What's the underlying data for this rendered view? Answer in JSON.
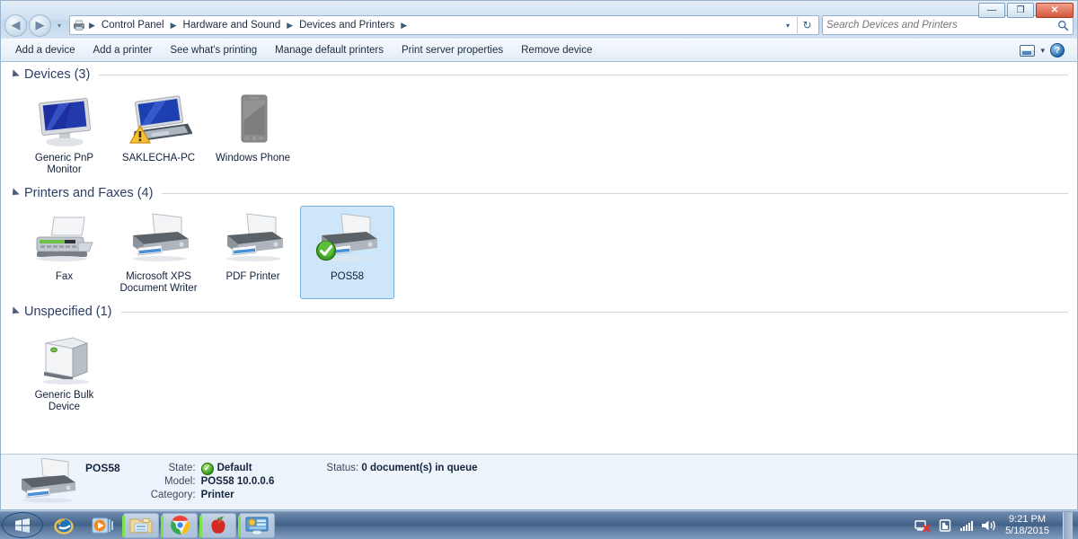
{
  "window": {
    "caption_buttons": [
      {
        "name": "minimize",
        "glyph": "—"
      },
      {
        "name": "maximize",
        "glyph": "❐"
      },
      {
        "name": "close",
        "glyph": "✕"
      }
    ],
    "address": {
      "icon": "devices-printers-icon",
      "breadcrumbs": [
        "Control Panel",
        "Hardware and Sound",
        "Devices and Printers"
      ],
      "separator": "▶",
      "dropdown_glyph": "▾",
      "refresh_glyph": "↻"
    },
    "search": {
      "placeholder": "Search Devices and Printers",
      "value": "",
      "icon": "search-icon"
    },
    "nav": {
      "back_glyph": "◀",
      "forward_glyph": "▶",
      "recent_glyph": "▾"
    }
  },
  "toolbar": {
    "items": [
      "Add a device",
      "Add a printer",
      "See what's printing",
      "Manage default printers",
      "Print server properties",
      "Remove device"
    ],
    "view_chevron": "▾",
    "help_glyph": "?"
  },
  "groups": [
    {
      "title": "Devices (3)",
      "items": [
        {
          "label": "Generic PnP Monitor",
          "icon": "monitor-icon",
          "selected": false,
          "badge": ""
        },
        {
          "label": "SAKLECHA-PC",
          "icon": "laptop-icon",
          "selected": false,
          "badge": "warning-badge"
        },
        {
          "label": "Windows Phone",
          "icon": "phone-icon",
          "selected": false,
          "badge": ""
        }
      ]
    },
    {
      "title": "Printers and Faxes (4)",
      "items": [
        {
          "label": "Fax",
          "icon": "fax-icon",
          "selected": false,
          "badge": ""
        },
        {
          "label": "Microsoft XPS Document Writer",
          "icon": "printer-icon",
          "selected": false,
          "badge": ""
        },
        {
          "label": "PDF Printer",
          "icon": "printer-icon",
          "selected": false,
          "badge": ""
        },
        {
          "label": "POS58",
          "icon": "printer-icon",
          "selected": true,
          "badge": "default-check-badge"
        }
      ]
    },
    {
      "title": "Unspecified (1)",
      "items": [
        {
          "label": "Generic Bulk Device",
          "icon": "bulk-device-icon",
          "selected": false,
          "badge": ""
        }
      ]
    }
  ],
  "details": {
    "icon": "printer-icon",
    "name": "POS58",
    "labels": [
      "State:",
      "Model:",
      "Category:"
    ],
    "state_value": "Default",
    "model_value": "POS58 10.0.0.6",
    "category_value": "Printer",
    "status_label": "Status:",
    "status_value": "0 document(s) in queue"
  },
  "taskbar": {
    "start": "start-orb",
    "buttons": [
      {
        "name": "internet-explorer",
        "active": false,
        "pinned": false
      },
      {
        "name": "windows-media-player",
        "active": false,
        "pinned": false
      },
      {
        "name": "windows-explorer",
        "active": true,
        "pinned": true
      },
      {
        "name": "google-chrome",
        "active": true,
        "pinned": true
      },
      {
        "name": "apple-app",
        "active": true,
        "pinned": true
      },
      {
        "name": "control-panel",
        "active": true,
        "pinned": true
      }
    ],
    "tray": {
      "network_icon": "network-error-icon",
      "action_center_icon": "action-center-flag-icon",
      "signal_icon": "signal-bars-icon",
      "volume_icon": "volume-icon"
    },
    "clock": {
      "time": "9:21 PM",
      "date": "5/18/2015"
    }
  },
  "colors": {
    "selection_fill": "#cde6f9",
    "selection_border": "#7ab0dd",
    "group_title": "#2c3e66",
    "details_bg": "#eef4fb",
    "taskbar": "#3f5f86"
  }
}
